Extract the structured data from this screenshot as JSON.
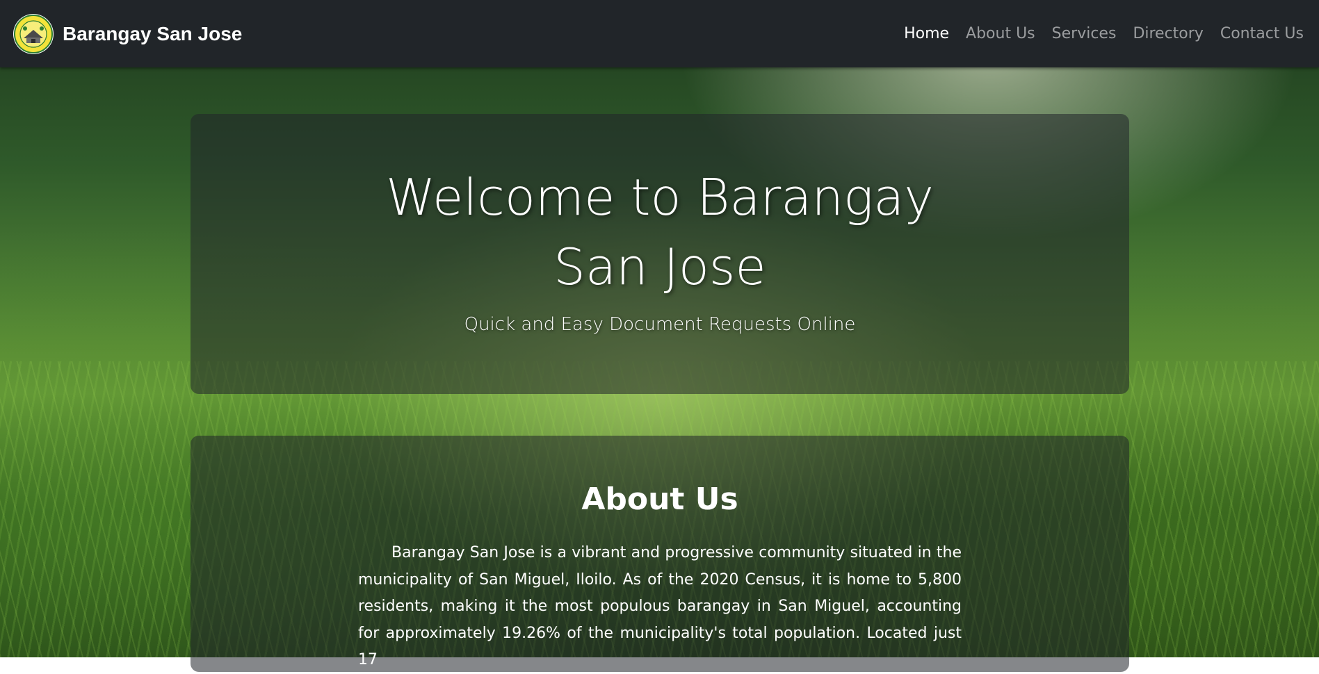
{
  "nav": {
    "brand": "Barangay San Jose",
    "links": [
      {
        "label": "Home",
        "active": true
      },
      {
        "label": "About Us",
        "active": false
      },
      {
        "label": "Services",
        "active": false
      },
      {
        "label": "Directory",
        "active": false
      },
      {
        "label": "Contact Us",
        "active": false
      }
    ]
  },
  "hero": {
    "title": "Welcome to Barangay San Jose",
    "subtitle": "Quick and Easy Document Requests Online"
  },
  "about": {
    "title": "About Us",
    "paragraph": "Barangay San Jose is a vibrant and progressive community situated in the municipality of San Miguel, Iloilo. As of the 2020 Census, it is home to 5,800 residents, making it the most populous barangay in San Miguel, accounting for approximately 19.26% of the municipality's total population. Located just 17"
  },
  "colors": {
    "navbar": "#212529",
    "nav_active": "#ffffff",
    "nav_inactive": "rgba(255,255,255,0.55)",
    "panel": "rgba(33,37,41,0.55)"
  }
}
